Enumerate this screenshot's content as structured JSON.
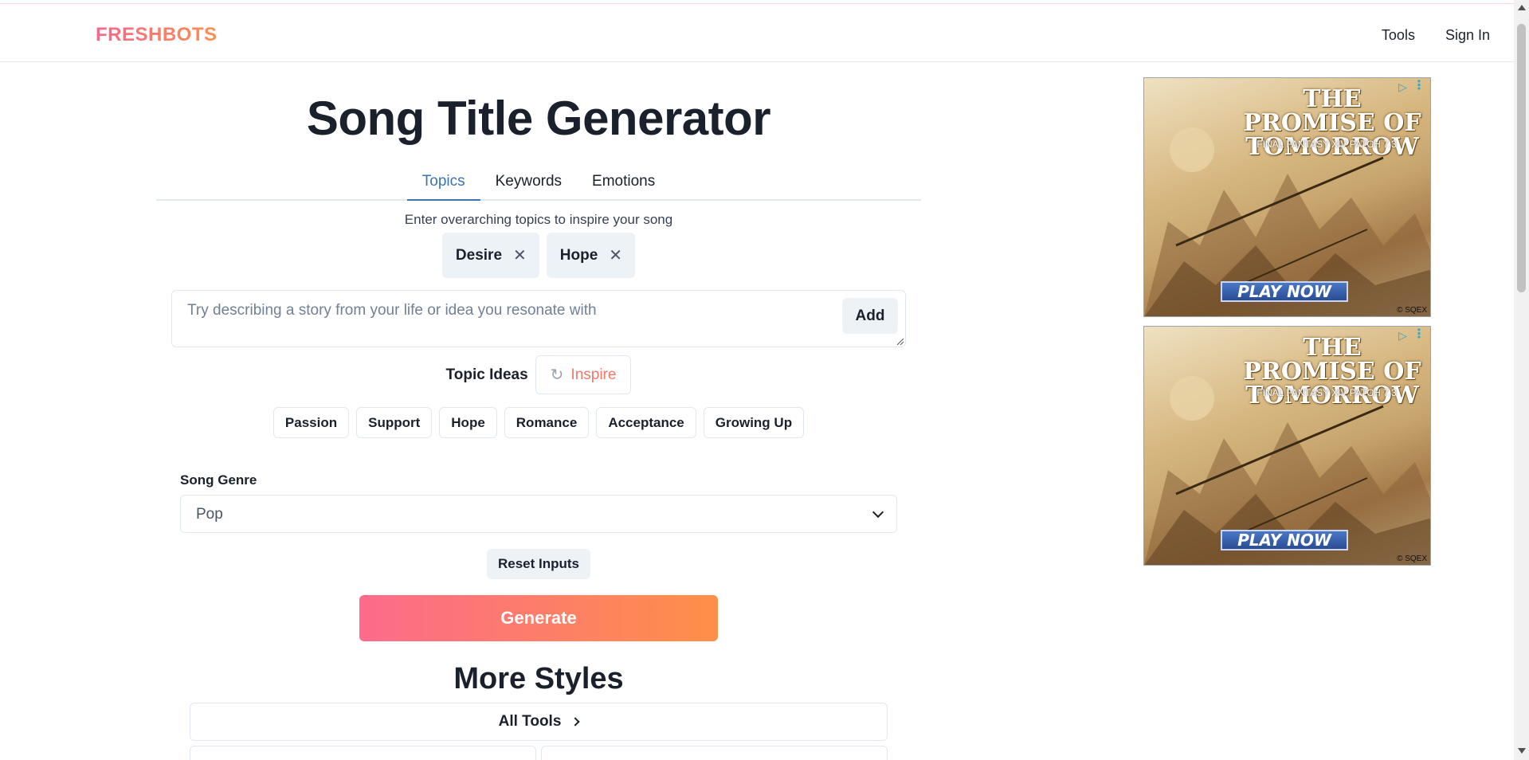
{
  "brand": {
    "logo": "FRESHBOTS"
  },
  "nav": {
    "tools": "Tools",
    "sign_in": "Sign In"
  },
  "page": {
    "title": "Song Title Generator"
  },
  "tabs": [
    {
      "label": "Topics",
      "active": true
    },
    {
      "label": "Keywords",
      "active": false
    },
    {
      "label": "Emotions",
      "active": false
    }
  ],
  "topics": {
    "hint": "Enter overarching topics to inspire your song",
    "chips": [
      "Desire",
      "Hope"
    ],
    "input_placeholder": "Try describing a story from your life or idea you resonate with",
    "add_label": "Add",
    "ideas_label": "Topic Ideas",
    "inspire_label": "Inspire",
    "ideas": [
      "Passion",
      "Support",
      "Hope",
      "Romance",
      "Acceptance",
      "Growing Up"
    ]
  },
  "genre": {
    "label": "Song Genre",
    "selected": "Pop"
  },
  "actions": {
    "reset": "Reset Inputs",
    "generate": "Generate"
  },
  "more": {
    "title": "More Styles",
    "all_tools": "All Tools"
  },
  "ads": [
    {
      "title": "THE PROMISE OF TOMORROW",
      "subtitle": "FINAL FANTASY XIV PATCH 7.3",
      "cta": "PLAY NOW",
      "copyright": "© SQEX"
    },
    {
      "title": "THE PROMISE OF TOMORROW",
      "subtitle": "FINAL FANTASY XIV PATCH 7.3",
      "cta": "PLAY NOW",
      "copyright": "© SQEX"
    }
  ],
  "colors": {
    "brand_gradient_start": "#f8668a",
    "brand_gradient_end": "#fd8f4f",
    "active_tab": "#3b73b5",
    "inspire": "#f8766a"
  }
}
